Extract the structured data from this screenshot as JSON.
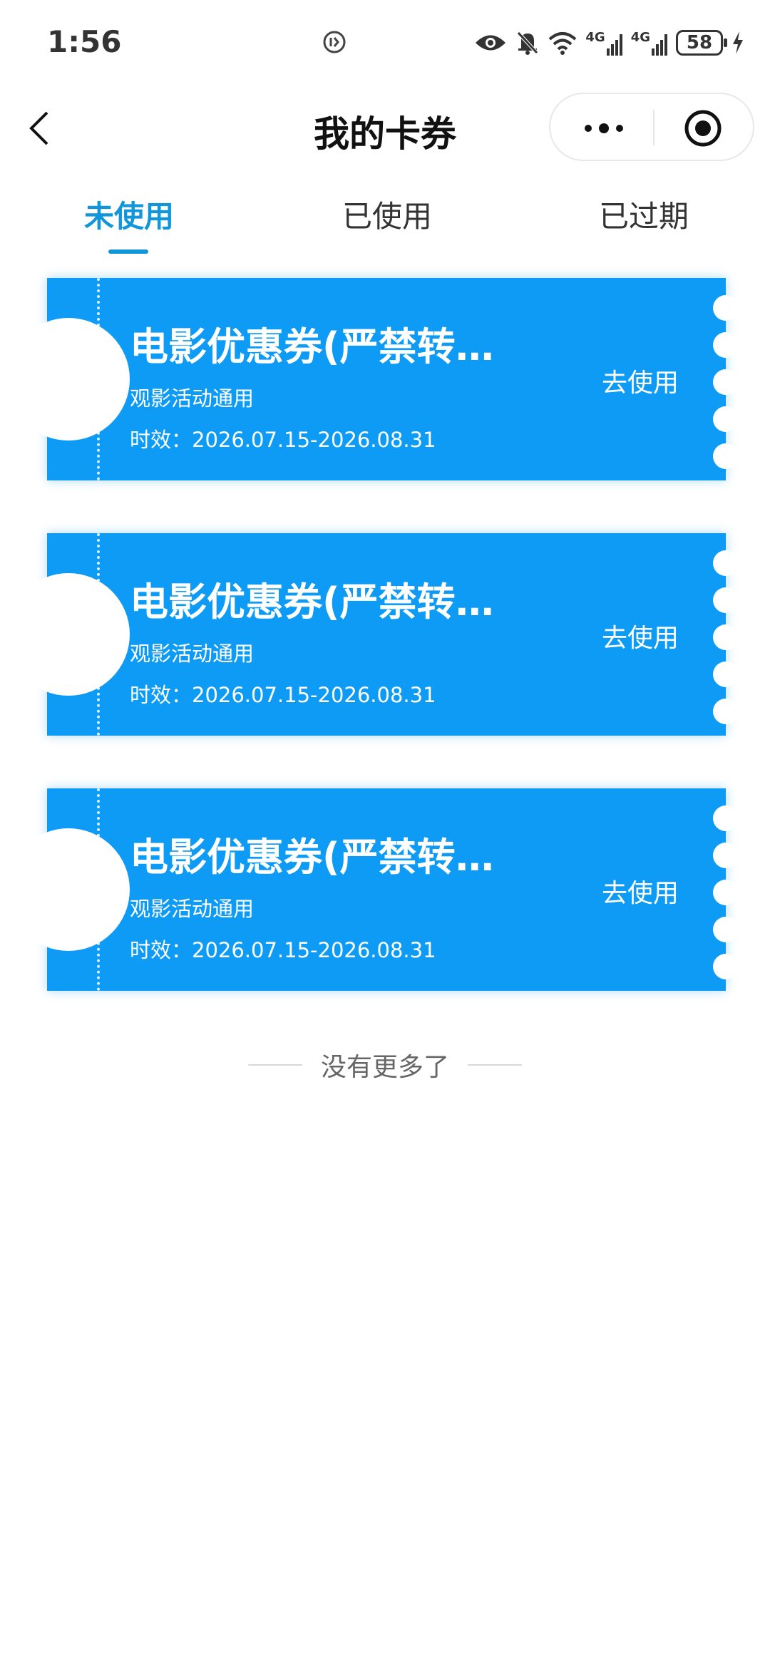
{
  "status_bar": {
    "time": "1:56",
    "icons": [
      "sync-icon",
      "eye-icon",
      "bell-muted-icon",
      "wifi-icon",
      "signal-4g-icon",
      "signal-4g-icon",
      "battery-icon",
      "charging-icon"
    ],
    "network_label_1": "4G",
    "network_label_2": "4G",
    "battery": "58"
  },
  "nav": {
    "title": "我的卡券"
  },
  "tabs": [
    {
      "label": "未使用",
      "active": true
    },
    {
      "label": "已使用",
      "active": false
    },
    {
      "label": "已过期",
      "active": false
    }
  ],
  "coupons": [
    {
      "title": "电影优惠券(严禁转卖…",
      "desc": "观影活动通用",
      "validity": "时效：2026.07.15-2026.08.31",
      "action": "去使用"
    },
    {
      "title": "电影优惠券(严禁转卖…",
      "desc": "观影活动通用",
      "validity": "时效：2026.07.15-2026.08.31",
      "action": "去使用"
    },
    {
      "title": "电影优惠券(严禁转卖…",
      "desc": "观影活动通用",
      "validity": "时效：2026.07.15-2026.08.31",
      "action": "去使用"
    }
  ],
  "footer": {
    "no_more": "没有更多了"
  },
  "colors": {
    "accent": "#1296db",
    "coupon_bg": "#0e9bf5"
  }
}
